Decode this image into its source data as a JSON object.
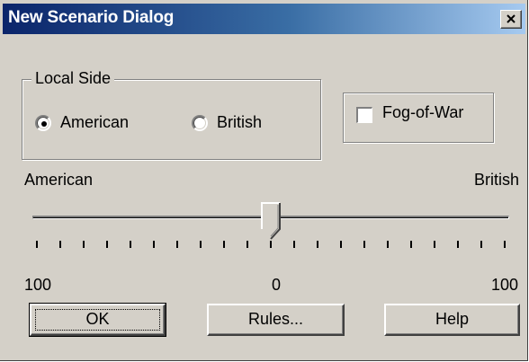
{
  "window": {
    "title": "New Scenario Dialog"
  },
  "local_side": {
    "legend": "Local Side",
    "options": [
      {
        "label": "American",
        "selected": true
      },
      {
        "label": "British",
        "selected": false
      }
    ]
  },
  "fog_of_war": {
    "label": "Fog-of-War",
    "checked": false
  },
  "slider": {
    "left_label": "American",
    "right_label": "British",
    "scale": {
      "left": "100",
      "center": "0",
      "right": "100"
    },
    "value": 0,
    "min": -100,
    "max": 100,
    "tick_count": 21
  },
  "buttons": {
    "ok": "OK",
    "rules": "Rules...",
    "help": "Help"
  },
  "colors": {
    "title_start": "#0a246a",
    "title_end": "#a6caf0",
    "face": "#d4d0c8"
  }
}
